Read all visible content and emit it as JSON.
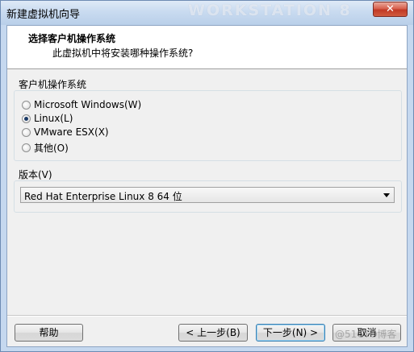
{
  "window": {
    "title": "新建虚拟机向导",
    "watermark": "WORKSTATION 8",
    "close_label": "✕"
  },
  "header": {
    "title": "选择客户机操作系统",
    "subtitle": "此虚拟机中将安装哪种操作系统?"
  },
  "os_group": {
    "label": "客户机操作系统",
    "options": [
      {
        "label": "Microsoft Windows(W)",
        "checked": false
      },
      {
        "label": "Linux(L)",
        "checked": true
      },
      {
        "label": "VMware ESX(X)",
        "checked": false
      },
      {
        "label": "其他(O)",
        "checked": false
      }
    ]
  },
  "version_group": {
    "label": "版本(V)",
    "selected": "Red Hat Enterprise Linux 8 64 位"
  },
  "buttons": {
    "help": "帮助",
    "back": "< 上一步(B)",
    "next": "下一步(N) >",
    "cancel": "取消"
  },
  "corner_watermark": "@51CTO博客"
}
